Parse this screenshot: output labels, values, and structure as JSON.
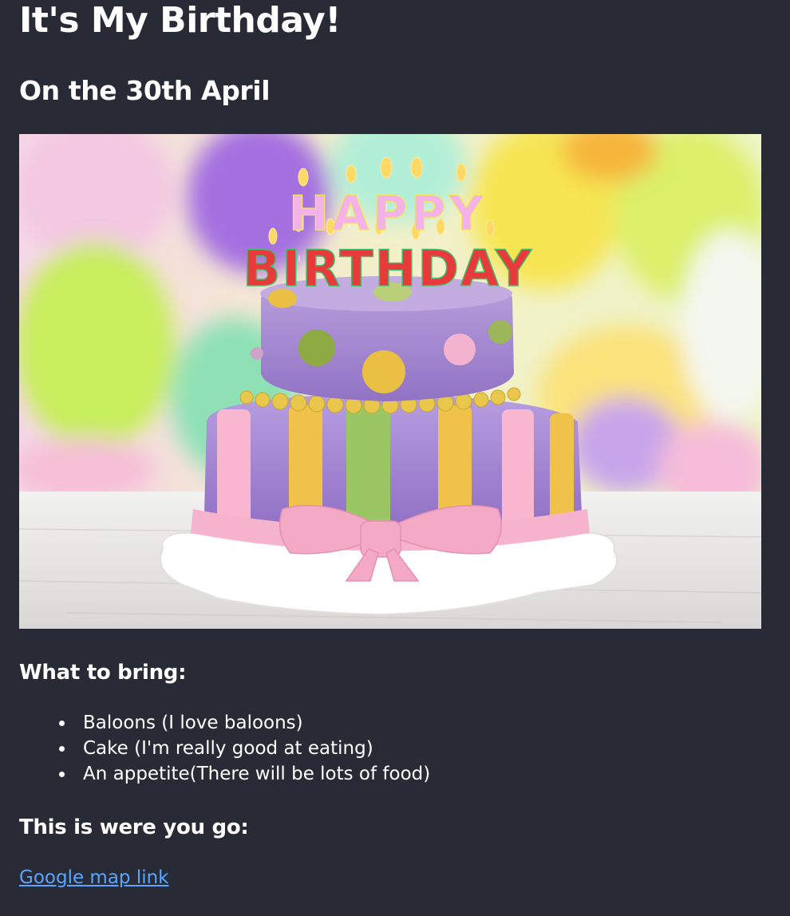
{
  "page": {
    "title": "It's My Birthday!",
    "subtitle": "On the 30th April"
  },
  "image": {
    "cake_topper_line1": "HAPPY",
    "cake_topper_line2": "BIRTHDAY"
  },
  "bring": {
    "heading": "What to bring:",
    "items": [
      "Baloons (I love baloons)",
      "Cake (I'm really good at eating)",
      "An appetite(There will be lots of food)"
    ]
  },
  "location": {
    "heading": "This is were you go:",
    "link_text": "Google map link"
  },
  "colors": {
    "background": "#282a36",
    "text": "#ffffff",
    "link": "#58a6ff"
  }
}
